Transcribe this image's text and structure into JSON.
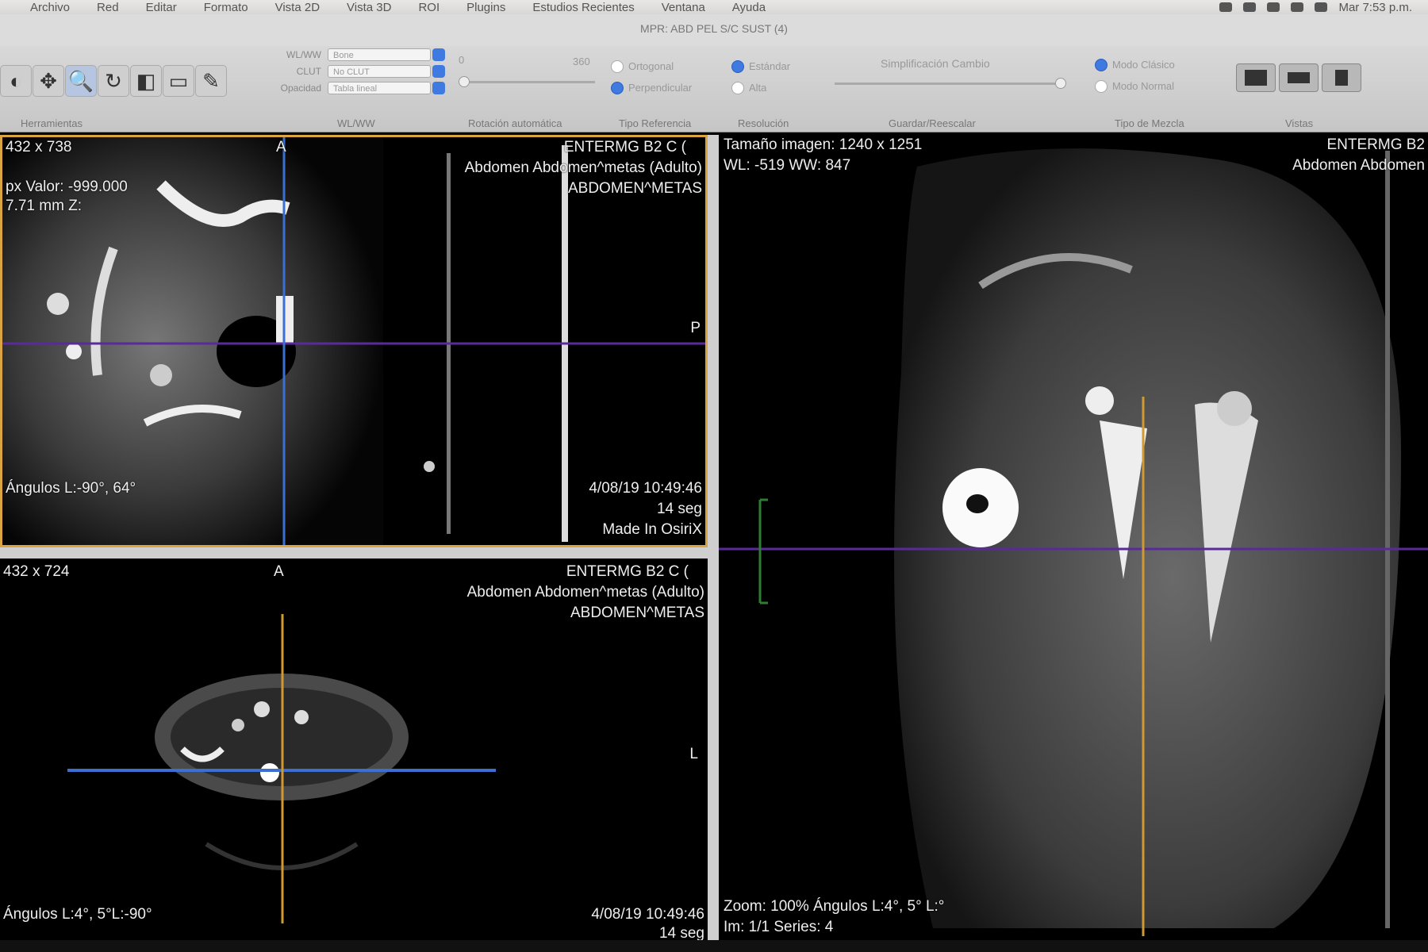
{
  "menubar": {
    "items": [
      "Archivo",
      "Red",
      "Editar",
      "Formato",
      "Vista 2D",
      "Vista 3D",
      "ROI",
      "Plugins",
      "Estudios Recientes",
      "Ventana",
      "Ayuda"
    ],
    "clock": "Mar 7:53 p.m."
  },
  "window": {
    "title": "MPR: ABD PEL S/C SUST (4)"
  },
  "toolbar": {
    "groups": {
      "tools": "Herramientas",
      "wlww": "WL/WW",
      "rotation": "Rotación automática",
      "ref_type": "Tipo Referencia",
      "resolution": "Resolución",
      "rescale": "Guardar/Reescalar",
      "blend": "Tipo de Mezcla",
      "views": "Vistas"
    },
    "wlww_fields": [
      {
        "label": "WL/WW",
        "value": "Bone"
      },
      {
        "label": "CLUT",
        "value": "No CLUT"
      },
      {
        "label": "Opacidad",
        "value": "Tabla lineal"
      }
    ],
    "ref_options": [
      "Ortogonal",
      "Perpendicular"
    ],
    "res_options": [
      "Estándar",
      "Alta"
    ],
    "rescale_label": "Simplificación Cambio",
    "blend_options": [
      "Modo Clásico",
      "Modo Normal"
    ],
    "slider_value": "0",
    "slider_max": "360"
  },
  "viewports": {
    "top_left": {
      "size": "432 x 738",
      "value_line": "px Valor: -999.000",
      "pos_line": "7.71 mm Z: ",
      "scanner": "ENTERMG B2 C (",
      "study": "Abdomen Abdomen^metas (Adulto)",
      "series": "ABDOMEN^METAS",
      "angles": "Ángulos L:-90°, 64°",
      "date": "4/08/19 10:49:46",
      "time": "14 seg",
      "made_in": "Made In OsiriX",
      "orient_top": "A",
      "orient_right": "P"
    },
    "bottom_left": {
      "size": "432 x 724",
      "scanner": "ENTERMG B2 C (",
      "study": "Abdomen Abdomen^metas (Adulto)",
      "series": "ABDOMEN^METAS",
      "angles": "Ángulos L:4°, 5°L:-90°",
      "date": "4/08/19 10:49:46",
      "time": "14 seg",
      "orient_top": "A",
      "orient_right": "L"
    },
    "right": {
      "size_line": "Tamaño imagen: 1240 x 1251",
      "wl_line": "WL: -519 WW: 847",
      "scanner": "ENTERMG B2",
      "study": "Abdomen Abdomen",
      "zoom_line": "Zoom: 100% Ángulos L:4°, 5° L:°",
      "img_line": "Im: 1/1  Series: 4"
    }
  },
  "colors": {
    "active_border": "#d9a441",
    "crosshair_purple": "#5a2a9c",
    "crosshair_blue": "#3b6fd0",
    "crosshair_yellow": "#d09a32",
    "accent": "#3f7ae0"
  }
}
